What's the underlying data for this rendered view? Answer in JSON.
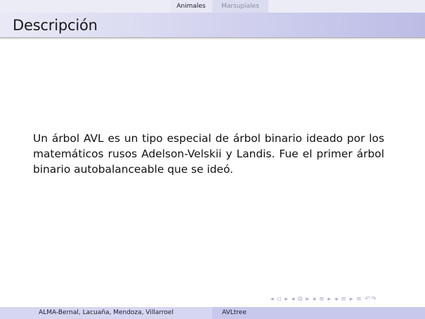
{
  "nav": {
    "sections": [
      "Animales",
      "Marsupiales"
    ]
  },
  "frame": {
    "title": "Descripción",
    "body": "Un árbol AVL es un tipo especial de árbol binario ideado por los matemáticos rusos Adelson-Velskii y Landis. Fue el primer árbol binario autobalanceable que se ideó."
  },
  "navigation_symbols": "◂ ▫ ▸ ◂ ⧉ ▸ ◂ ≡ ▸ ◂ ≡ ▸ ≡ ↶↷",
  "footer": {
    "author": "ALMA-Bernal, Lacuaña, Mendoza, Villarroel",
    "title": "AVLtree"
  },
  "colors": {
    "nav_background": "#ececf6",
    "title_background": "#cfcfee",
    "footer_background": "#cfcfee",
    "inactive_section_text": "#8a8aa8"
  }
}
